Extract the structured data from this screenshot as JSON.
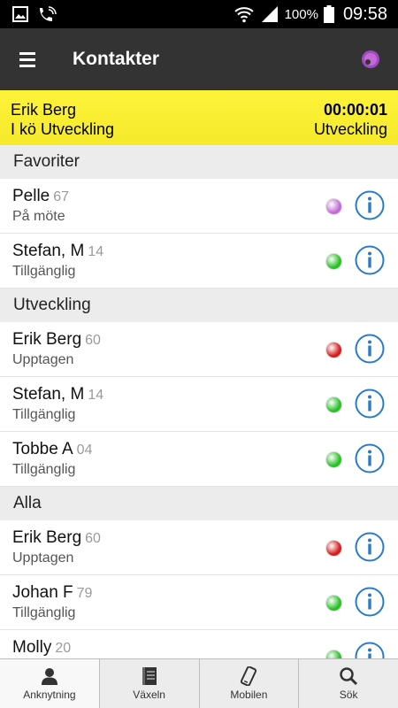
{
  "status_bar": {
    "battery": "100%",
    "time": "09:58"
  },
  "app_bar": {
    "title": "Kontakter"
  },
  "call": {
    "name": "Erik Berg",
    "queue": "I kö Utveckling",
    "timer": "00:00:01",
    "department": "Utveckling"
  },
  "colors": {
    "accent_yellow": "#fdf33a",
    "busy": "#d81b1b",
    "available": "#26c226",
    "meeting": "#c46ad8",
    "info_blue": "#2a7bc6"
  },
  "sections": [
    {
      "title": "Favoriter",
      "rows": [
        {
          "name": "Pelle",
          "ext": "67",
          "status": "På möte",
          "color": "#c46ad8"
        },
        {
          "name": "Stefan, M",
          "ext": "14",
          "status": "Tillgänglig",
          "color": "#26c226"
        }
      ]
    },
    {
      "title": "Utveckling",
      "rows": [
        {
          "name": "Erik Berg",
          "ext": "60",
          "status": "Upptagen",
          "color": "#d81b1b"
        },
        {
          "name": "Stefan, M",
          "ext": "14",
          "status": "Tillgänglig",
          "color": "#26c226"
        },
        {
          "name": "Tobbe A",
          "ext": "04",
          "status": "Tillgänglig",
          "color": "#26c226"
        }
      ]
    },
    {
      "title": "Alla",
      "rows": [
        {
          "name": "Erik Berg",
          "ext": "60",
          "status": "Upptagen",
          "color": "#d81b1b"
        },
        {
          "name": "Johan F",
          "ext": "79",
          "status": "Tillgänglig",
          "color": "#26c226"
        },
        {
          "name": "Molly",
          "ext": "20",
          "status": "",
          "color": "#26c226"
        }
      ]
    }
  ],
  "tabs": [
    {
      "label": "Anknytning",
      "icon": "person-icon",
      "active": true
    },
    {
      "label": "Växeln",
      "icon": "switchboard-icon",
      "active": false
    },
    {
      "label": "Mobilen",
      "icon": "mobile-icon",
      "active": false
    },
    {
      "label": "Sök",
      "icon": "search-icon",
      "active": false
    }
  ]
}
